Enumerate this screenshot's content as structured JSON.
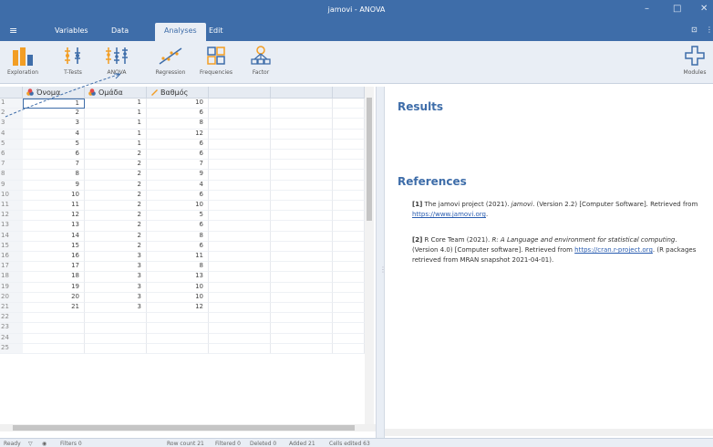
{
  "window": {
    "title": "jamovi - ANOVA",
    "minimize": "–",
    "maximize": "□",
    "close": "✕"
  },
  "menu": {
    "tabs": [
      {
        "label": "Variables"
      },
      {
        "label": "Data"
      },
      {
        "label": "Analyses"
      },
      {
        "label": "Edit"
      }
    ],
    "active_tab": "Analyses",
    "hamburger": "≡",
    "right_1": "⊡",
    "right_2": "⋮"
  },
  "ribbon": {
    "buttons": [
      {
        "label": "Exploration",
        "icon": "bar-chart-icon"
      },
      {
        "label": "T-Tests",
        "icon": "t-test-icon"
      },
      {
        "label": "ANOVA",
        "icon": "anova-icon"
      },
      {
        "label": "Regression",
        "icon": "regression-icon"
      },
      {
        "label": "Frequencies",
        "icon": "frequencies-icon"
      },
      {
        "label": "Factor",
        "icon": "factor-icon"
      }
    ],
    "modules_label": "Modules",
    "colors": {
      "accent": "#3e6da9",
      "icon_orange": "#f29e25",
      "icon_blue": "#3e6da9"
    }
  },
  "spreadsheet": {
    "columns": [
      {
        "name": "Όνομα",
        "icon": "nominal-icon"
      },
      {
        "name": "Ομάδα",
        "icon": "nominal-icon"
      },
      {
        "name": "Βαθμός",
        "icon": "continuous-icon"
      }
    ],
    "rows": [
      [
        1,
        1,
        10
      ],
      [
        2,
        1,
        6
      ],
      [
        3,
        1,
        8
      ],
      [
        4,
        1,
        12
      ],
      [
        5,
        1,
        6
      ],
      [
        6,
        2,
        6
      ],
      [
        7,
        2,
        7
      ],
      [
        8,
        2,
        9
      ],
      [
        9,
        2,
        4
      ],
      [
        10,
        2,
        6
      ],
      [
        11,
        2,
        10
      ],
      [
        12,
        2,
        5
      ],
      [
        13,
        2,
        6
      ],
      [
        14,
        2,
        8
      ],
      [
        15,
        2,
        6
      ],
      [
        16,
        3,
        11
      ],
      [
        17,
        3,
        8
      ],
      [
        18,
        3,
        13
      ],
      [
        19,
        3,
        10
      ],
      [
        20,
        3,
        10
      ],
      [
        21,
        3,
        12
      ]
    ],
    "row_numbers": [
      "1",
      "2",
      "3",
      "4",
      "5",
      "6",
      "7",
      "8",
      "9",
      "10",
      "11",
      "12",
      "13",
      "14",
      "15",
      "16",
      "17",
      "18",
      "19",
      "20",
      "21",
      "22",
      "23",
      "24",
      "25"
    ]
  },
  "results": {
    "heading": "Results",
    "references_heading": "References",
    "ref1": {
      "num": "[1]",
      "pre": "The jamovi project (2021). ",
      "italic": "jamovi",
      "mid": ". (Version 2.2) [Computer Software]. Retrieved from ",
      "link": "https://www.jamovi.org",
      "post": "."
    },
    "ref2": {
      "num": "[2]",
      "pre": "R Core Team (2021). ",
      "italic": "R: A Language and environment for statistical computing",
      "mid": ". (Version 4.0) [Computer software]. Retrieved from ",
      "link": "https://cran.r-project.org",
      "post": ". (R packages retrieved from MRAN snapshot 2021-04-01)."
    }
  },
  "status": {
    "ready": "Ready",
    "filters": "Filters 0",
    "row_count": "Row count 21",
    "filtered": "Filtered 0",
    "deleted": "Deleted 0",
    "added": "Added 21",
    "cells_edited": "Cells edited 63"
  }
}
